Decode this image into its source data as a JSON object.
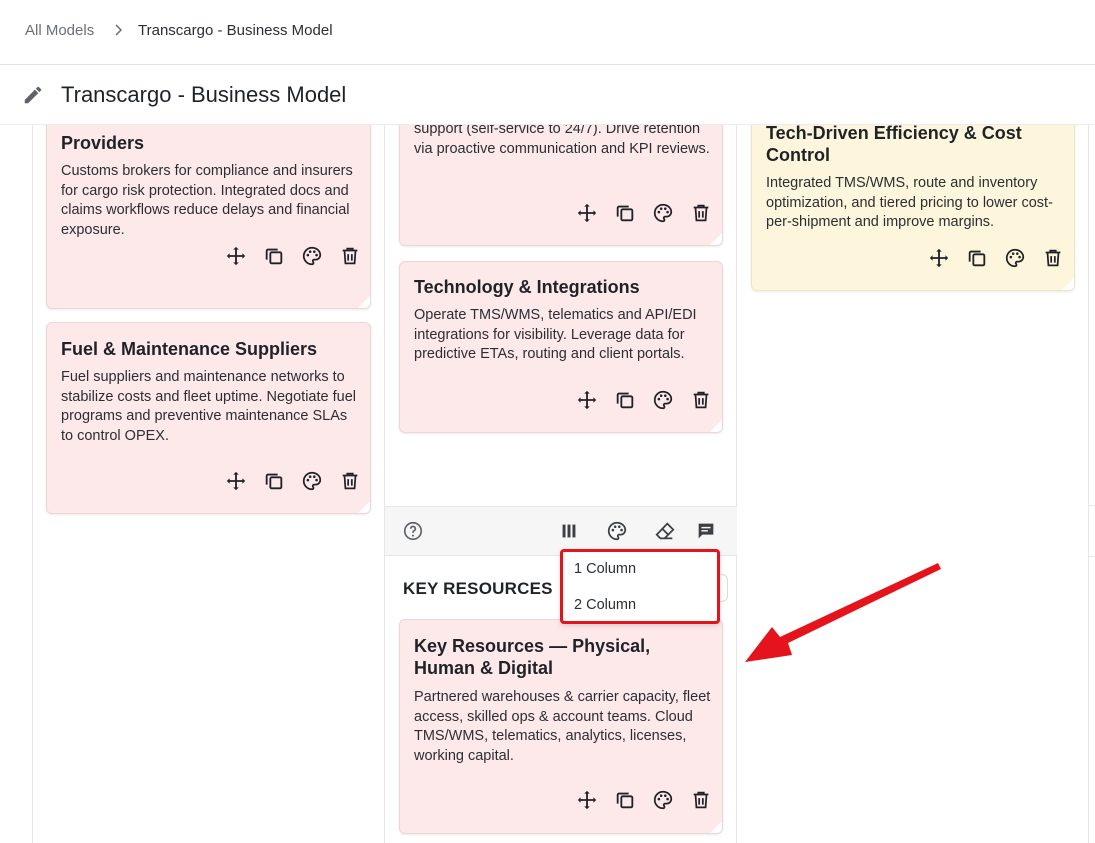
{
  "breadcrumb": {
    "root": "All Models",
    "current": "Transcargo - Business Model"
  },
  "header": {
    "title": "Transcargo - Business Model"
  },
  "cards": [
    {
      "title": "Providers",
      "body": "Customs brokers for compliance and insurers for cargo risk protection. Integrated docs and claims workflows reduce delays and financial exposure."
    },
    {
      "title": "Fuel & Maintenance Suppliers",
      "body": "Fuel suppliers and maintenance networks to stabilize costs and fleet uptime. Negotiate fuel programs and preventive maintenance SLAs to control OPEX."
    },
    {
      "title": "",
      "body": "support (self-service to 24/7). Drive retention via proactive communication and KPI reviews."
    },
    {
      "title": "Technology & Integrations",
      "body": "Operate TMS/WMS, telematics and API/EDI integrations for visibility. Leverage data for predictive ETAs, routing and client portals."
    },
    {
      "title": "Tech-Driven Efficiency & Cost Control",
      "body": "Integrated TMS/WMS, route and inventory optimization, and tiered pricing to lower cost-per-shipment and improve margins."
    },
    {
      "title": "Key Resources — Physical, Human & Digital",
      "body": "Partnered warehouses & carrier capacity, fleet access, skilled ops & account teams. Cloud TMS/WMS, telematics, analytics, licenses, working capital."
    }
  ],
  "card_actions": [
    "move-icon",
    "duplicate-icon",
    "palette-icon",
    "trash-icon"
  ],
  "section": {
    "heading": "KEY RESOURCES"
  },
  "toolbar": [
    "help-icon",
    "columns-icon",
    "palette-icon",
    "eraser-icon",
    "comment-icon"
  ],
  "column_menu": {
    "options": [
      "1 Column",
      "2 Column"
    ]
  },
  "colors": {
    "card_pink": "#fde8ea",
    "card_yellow": "#fdf6dc",
    "highlight_red": "#e5141c"
  }
}
